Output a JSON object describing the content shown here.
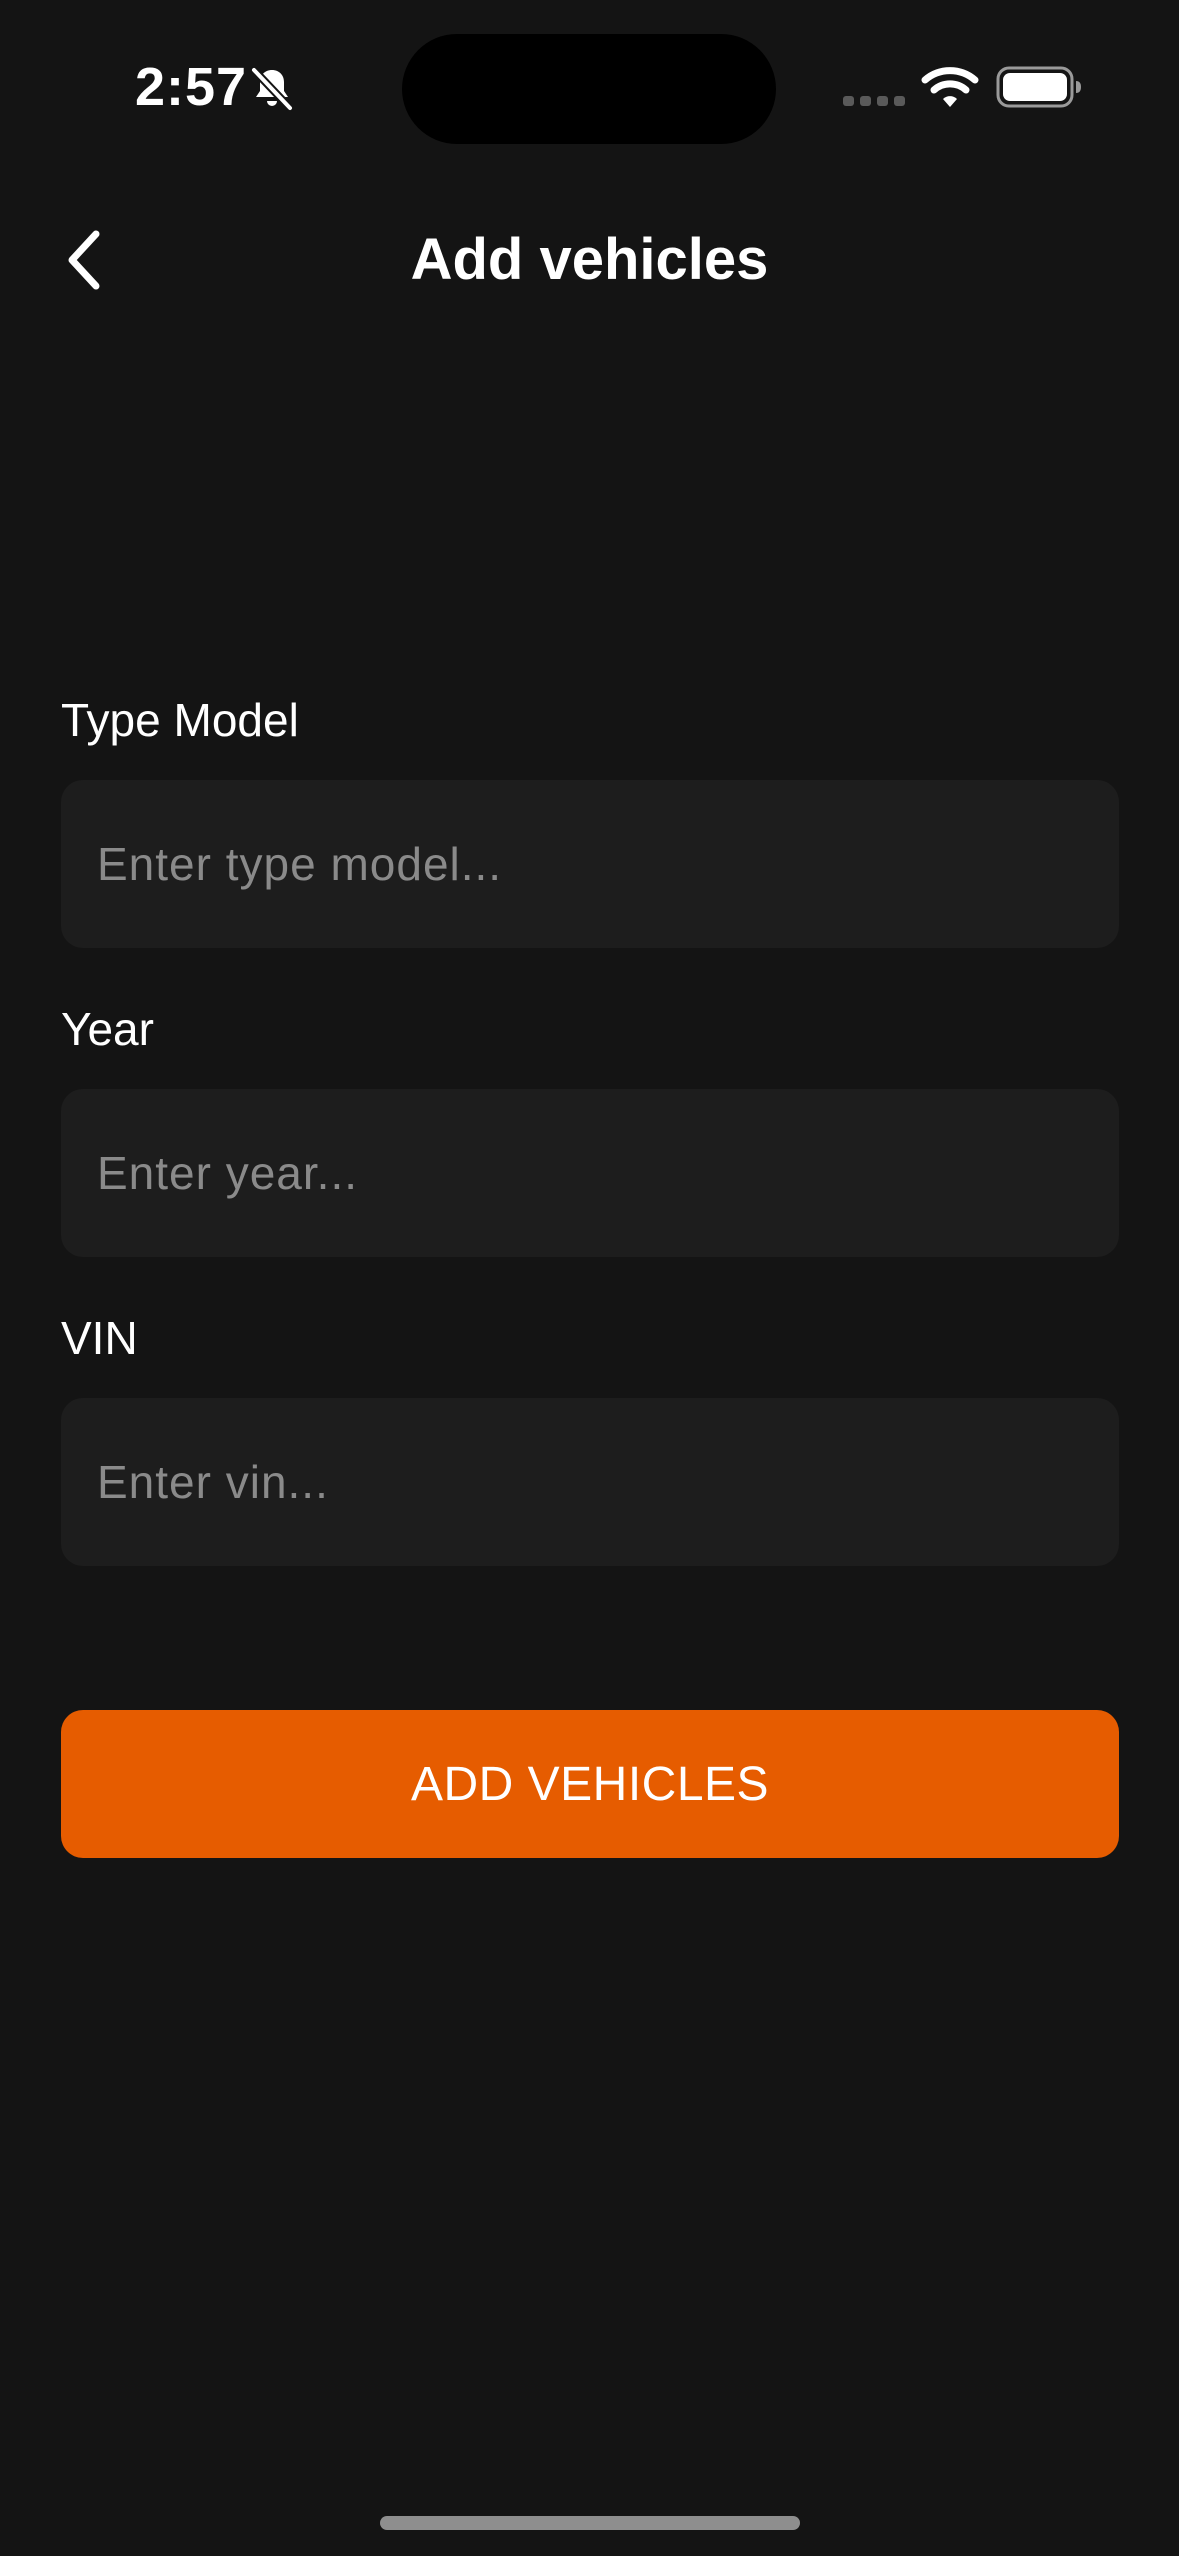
{
  "status_bar": {
    "time": "2:57"
  },
  "header": {
    "title": "Add vehicles"
  },
  "form": {
    "type_model": {
      "label": "Type Model",
      "placeholder": "Enter type model...",
      "value": ""
    },
    "year": {
      "label": "Year",
      "placeholder": "Enter year...",
      "value": ""
    },
    "vin": {
      "label": "VIN",
      "placeholder": "Enter vin...",
      "value": ""
    },
    "submit_label": "ADD VEHICLES"
  },
  "colors": {
    "background": "#141414",
    "input_background": "#1d1d1d",
    "accent": "#e65c00",
    "placeholder": "#8a8a8a"
  },
  "icons": {
    "back": "chevron-left-icon",
    "bell": "bell-slash-icon",
    "signal": "cellular-signal-icon",
    "wifi": "wifi-icon",
    "battery": "battery-icon"
  }
}
